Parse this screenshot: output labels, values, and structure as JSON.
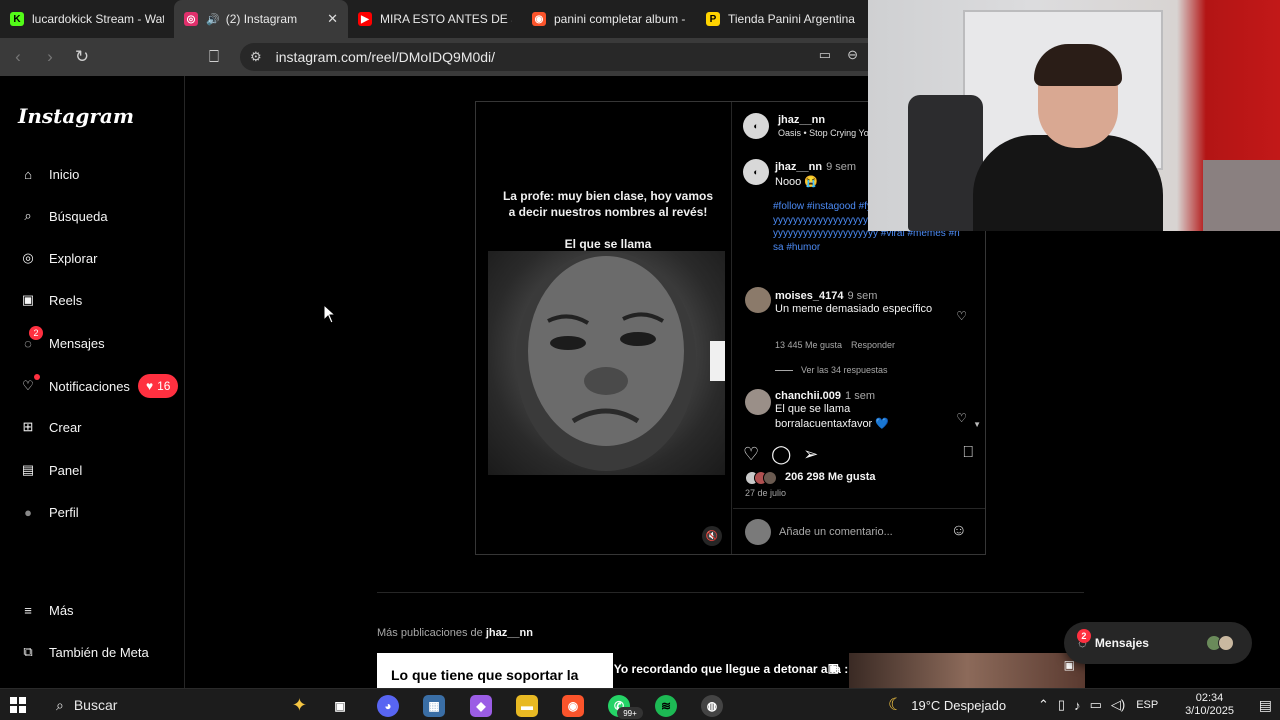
{
  "browser": {
    "tabs": [
      {
        "title": "lucardokick Stream - Watch",
        "icon": "kick-icon",
        "color": "#53fc18",
        "glyph": "K"
      },
      {
        "title": "(2) Instagram",
        "icon": "instagram-icon",
        "color": "#e1306c",
        "glyph": "◎",
        "active": true,
        "close": "✕"
      },
      {
        "title": "MIRA ESTO ANTES DE SUBIR",
        "icon": "youtube-icon",
        "color": "#ff0000",
        "glyph": "▶"
      },
      {
        "title": "panini completar album - B",
        "icon": "brave-search-icon",
        "color": "#fb542b",
        "glyph": "◉"
      },
      {
        "title": "Tienda Panini Argentina",
        "icon": "panini-icon",
        "color": "#ffd400",
        "glyph": "P"
      }
    ],
    "url": "instagram.com/reel/DMoIDQ9M0di/"
  },
  "sidebar": {
    "logo": "Instagram",
    "items": [
      {
        "label": "Inicio",
        "icon": "home-icon",
        "glyph": "⌂"
      },
      {
        "label": "Búsqueda",
        "icon": "search-icon",
        "glyph": "⌕"
      },
      {
        "label": "Explorar",
        "icon": "compass-icon",
        "glyph": "◎"
      },
      {
        "label": "Reels",
        "icon": "reels-icon",
        "glyph": "▣"
      },
      {
        "label": "Mensajes",
        "icon": "messenger-icon",
        "glyph": "◌",
        "badge": "2"
      },
      {
        "label": "Notificaciones",
        "icon": "heart-icon",
        "glyph": "♡",
        "pill": "16"
      },
      {
        "label": "Crear",
        "icon": "plus-square-icon",
        "glyph": "⊞"
      },
      {
        "label": "Panel",
        "icon": "chart-icon",
        "glyph": "▤"
      },
      {
        "label": "Perfil",
        "icon": "profile-avatar",
        "glyph": "●"
      },
      {
        "label": "Más",
        "icon": "menu-icon",
        "glyph": "≡"
      },
      {
        "label": "También de Meta",
        "icon": "meta-apps-icon",
        "glyph": "⧉"
      }
    ],
    "notif_heart": "♥"
  },
  "post": {
    "caption_top": "La profe: muy bien clase, hoy vamos a decir nuestros nombres al revés!",
    "caption_mid": "El que se llama sodutipsalirogsolnatsugem:",
    "author": "jhaz__nn",
    "audio": "Oasis • Stop Crying Yo",
    "caption_user": "jhaz__nn",
    "caption_time": "9 sem",
    "caption_text": "Nooo 😭",
    "hashtags": "#follow #instagood #fyyyyyyyyyyyyyyyyyyyyyyyyyyyyyyyyyyyyyyyyyyyyyyyyyyyyyyyyyyyyyyyyyyyyyyyyyyyyyy #viral #memes #risa #humor",
    "comments": [
      {
        "user": "moises_4174",
        "time": "9 sem",
        "text": "Un meme demasiado específico",
        "likes": "13 445 Me gusta",
        "reply": "Responder",
        "replies": "Ver las 34 respuestas"
      },
      {
        "user": "chanchii.009",
        "time": "1 sem",
        "text": "El que se llama borralacuentaxfavor 💙"
      }
    ],
    "likes": "206 298 Me gusta",
    "date": "27 de julio",
    "comment_placeholder": "Añade un comentario..."
  },
  "more_posts": {
    "prefix": "Más publicaciones de",
    "user": "jhaz__nn",
    "thumb1": "Lo que tiene que soportar la",
    "thumb2": "Yo recordando que llegue a detonar a la :"
  },
  "messages_pill": {
    "label": "Mensajes",
    "badge": "2"
  },
  "taskbar": {
    "search": "Buscar",
    "weather": "19°C  Despejado",
    "lang": "ESP",
    "time": "02:34",
    "date": "3/10/2025",
    "badge_99": "99+"
  }
}
